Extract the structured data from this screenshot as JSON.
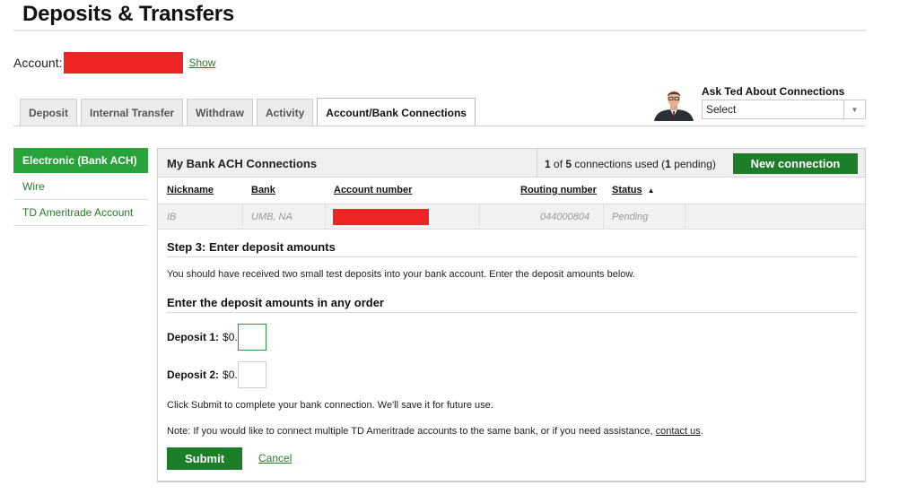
{
  "page": {
    "title": "Deposits & Transfers"
  },
  "account": {
    "label": "Account:",
    "show_link": "Show",
    "redaction_color": "#ee2424"
  },
  "tabs": [
    {
      "label": "Deposit",
      "active": false
    },
    {
      "label": "Internal Transfer",
      "active": false
    },
    {
      "label": "Withdraw",
      "active": false
    },
    {
      "label": "Activity",
      "active": false
    },
    {
      "label": "Account/Bank Connections",
      "active": true
    }
  ],
  "ask_ted": {
    "label": "Ask Ted About Connections",
    "select_value": "Select"
  },
  "sidebar": {
    "items": [
      {
        "label": "Electronic (Bank ACH)",
        "active": true
      },
      {
        "label": "Wire",
        "active": false
      },
      {
        "label": "TD Ameritrade Account",
        "active": false
      }
    ]
  },
  "connections": {
    "title": "My Bank ACH Connections",
    "used": {
      "count": "1",
      "of": "of",
      "total": "5",
      "middle": "connections used (",
      "pending": "1",
      "suffix": "pending)"
    },
    "new_button": "New connection",
    "columns": {
      "nickname": "Nickname",
      "bank": "Bank",
      "account_number": "Account number",
      "routing_number": "Routing number",
      "status": "Status"
    },
    "rows": [
      {
        "nickname": "IB",
        "bank": "UMB, NA",
        "routing_number": "044000804",
        "status": "Pending"
      }
    ]
  },
  "step": {
    "title": "Step 3: Enter deposit amounts",
    "intro": "You should have received two small test deposits into your bank account. Enter the deposit amounts below.",
    "order_title": "Enter the deposit amounts in any order",
    "deposit1_label": "Deposit 1:",
    "deposit2_label": "Deposit 2:",
    "amount_prefix": "$0.",
    "submit_note": "Click Submit to complete your bank connection. We'll save it for future use.",
    "note_text": "Note: If you would like to connect multiple TD Ameritrade accounts to the same bank, or if you need assistance, ",
    "contact_link": "contact us",
    "note_end": ".",
    "submit_button": "Submit",
    "cancel_link": "Cancel"
  },
  "colors": {
    "brand_green": "#1d7e2a",
    "active_green": "#27a33a",
    "link_green": "#2b7a2b"
  }
}
